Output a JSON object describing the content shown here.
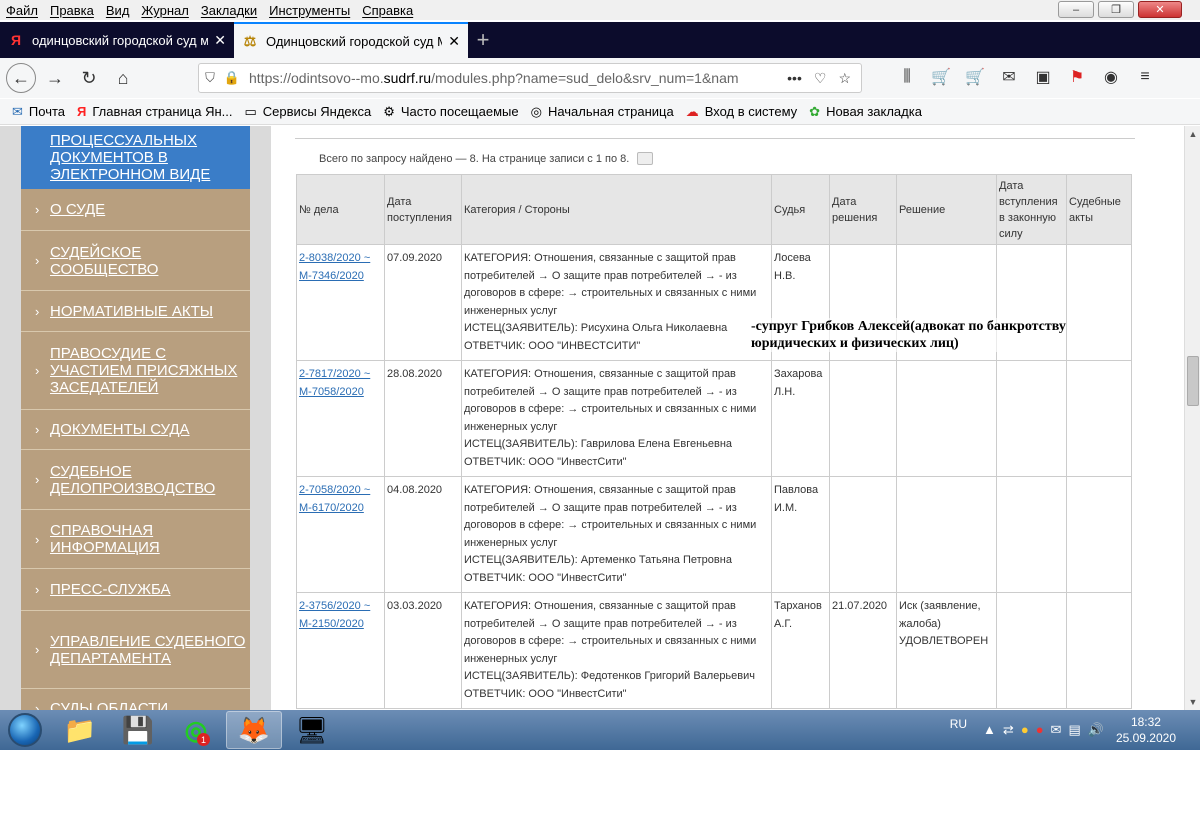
{
  "menubar": {
    "items": [
      "Файл",
      "Правка",
      "Вид",
      "Журнал",
      "Закладки",
      "Инструменты",
      "Справка"
    ]
  },
  "window_controls": {
    "minimize": "–",
    "restore": "❐",
    "close": "✕"
  },
  "tabs": [
    {
      "title": "одинцовский городской суд м",
      "favicon": "Я",
      "active": false
    },
    {
      "title": "Одинцовский городской суд М",
      "favicon": "⚖",
      "active": true
    }
  ],
  "urlbar": {
    "prefix": "https://odintsovo--mo.",
    "domain": "sudrf.ru",
    "rest": "/modules.php?name=sud_delo&srv_num=1&nam",
    "more": "•••"
  },
  "bookmarks": [
    {
      "label": "Почта",
      "icon": "✉"
    },
    {
      "label": "Главная страница Ян...",
      "icon": "Я"
    },
    {
      "label": "Сервисы Яндекса",
      "icon": "▭"
    },
    {
      "label": "Часто посещаемые",
      "icon": "⚙"
    },
    {
      "label": "Начальная страница",
      "icon": "◎"
    },
    {
      "label": "Вход в систему",
      "icon": "☁"
    },
    {
      "label": "Новая закладка",
      "icon": "✿"
    }
  ],
  "sidebar": {
    "top_item": "ПРОЦЕССУАЛЬНЫХ ДОКУМЕНТОВ В ЭЛЕКТРОННОМ ВИДЕ",
    "items": [
      {
        "label": "О СУДЕ"
      },
      {
        "label": "СУДЕЙСКОЕ СООБЩЕСТВО"
      },
      {
        "label": "НОРМАТИВНЫЕ АКТЫ"
      },
      {
        "label": "ПРАВОСУДИЕ С УЧАСТИЕМ ПРИСЯЖНЫХ ЗАСЕДАТЕЛЕЙ"
      },
      {
        "label": "ДОКУМЕНТЫ СУДА"
      },
      {
        "label": "СУДЕБНОЕ ДЕЛОПРОИЗВОДСТВО"
      },
      {
        "label": "СПРАВОЧНАЯ ИНФОРМАЦИЯ"
      },
      {
        "label": "ПРЕСС-СЛУЖБА"
      },
      {
        "label": "УПРАВЛЕНИЕ СУДЕБНОГО ДЕПАРТАМЕНТА"
      },
      {
        "label": "СУДЫ ОБЛАСТИ"
      }
    ]
  },
  "summary": "Всего по запросу найдено — 8. На странице записи с 1 по 8.",
  "table": {
    "headers": [
      "№ дела",
      "Дата поступления",
      "Категория / Стороны",
      "Судья",
      "Дата решения",
      "Решение",
      "Дата вступления в законную силу",
      "Судебные акты"
    ],
    "rows": [
      {
        "case": "2-8038/2020 ~ М-7346/2020",
        "date": "07.09.2020",
        "category": "КАТЕГОРИЯ: Отношения, связанные с защитой прав потребителей → О защите прав потребителей → - из договоров в сфере: → строительных и связанных с ними инженерных услуг",
        "plaintiff": "ИСТЕЦ(ЗАЯВИТЕЛЬ): Рисухина Ольга Николаевна",
        "defendant": "ОТВЕТЧИК: ООО \"ИНВЕСТСИТИ\"",
        "judge": "Лосева Н.В.",
        "decision_date": "",
        "decision": "",
        "effective": "",
        "acts": ""
      },
      {
        "case": "2-7817/2020 ~ М-7058/2020",
        "date": "28.08.2020",
        "category": "КАТЕГОРИЯ: Отношения, связанные с защитой прав потребителей → О защите прав потребителей → - из договоров в сфере: → строительных и связанных с ними инженерных услуг",
        "plaintiff": "ИСТЕЦ(ЗАЯВИТЕЛЬ): Гаврилова Елена Евгеньевна",
        "defendant": "ОТВЕТЧИК: ООО \"ИнвестСити\"",
        "judge": "Захарова Л.Н.",
        "decision_date": "",
        "decision": "",
        "effective": "",
        "acts": ""
      },
      {
        "case": "2-7058/2020 ~ М-6170/2020",
        "date": "04.08.2020",
        "category": "КАТЕГОРИЯ: Отношения, связанные с защитой прав потребителей → О защите прав потребителей → - из договоров в сфере: → строительных и связанных с ними инженерных услуг",
        "plaintiff": "ИСТЕЦ(ЗАЯВИТЕЛЬ): Артеменко Татьяна Петровна",
        "defendant": "ОТВЕТЧИК: ООО \"ИнвестСити\"",
        "judge": "Павлова И.М.",
        "decision_date": "",
        "decision": "",
        "effective": "",
        "acts": ""
      },
      {
        "case": "2-3756/2020 ~ М-2150/2020",
        "date": "03.03.2020",
        "category": "КАТЕГОРИЯ: Отношения, связанные с защитой прав потребителей → О защите прав потребителей → - из договоров в сфере: → строительных и связанных с ними инженерных услуг",
        "plaintiff": "ИСТЕЦ(ЗАЯВИТЕЛЬ): Федотенков Григорий Валерьевич",
        "defendant": "ОТВЕТЧИК: ООО \"ИнвестСити\"",
        "judge": "Тарханов А.Г.",
        "decision_date": "21.07.2020",
        "decision": "Иск (заявление, жалоба) УДОВЛЕТВОРЕН",
        "effective": "",
        "acts": ""
      }
    ]
  },
  "annotation": {
    "line1": "-супруг Грибков Алексей(адвокат по банкротству",
    "line2": "юридических и физических лиц)"
  },
  "taskbar": {
    "apps": [
      {
        "icon": "📁"
      },
      {
        "icon": "💾"
      },
      {
        "icon": "◎",
        "badge": "1"
      },
      {
        "icon": "🦊",
        "active": true
      },
      {
        "icon": "🖥"
      }
    ],
    "lang": "RU",
    "time": "18:32",
    "date": "25.09.2020"
  }
}
